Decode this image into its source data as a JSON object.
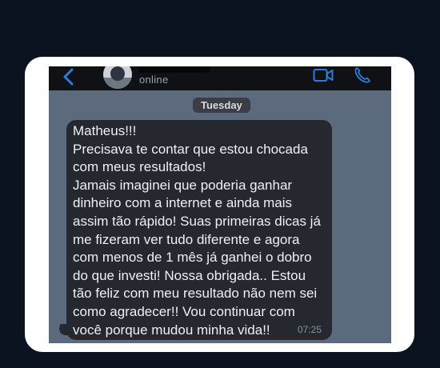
{
  "header": {
    "status": "online",
    "back_icon": "chevron-left-icon",
    "video_icon": "video-call-icon",
    "phone_icon": "phone-icon",
    "accent_color": "#2f7bd8"
  },
  "chat": {
    "date_label": "Tuesday",
    "message": {
      "text": "Matheus!!!\nPrecisava te contar que estou chocada com meus resultados!\nJamais imaginei que poderia ganhar dinheiro com a internet e ainda mais assim tão rápido! Suas primeiras dicas já me fizeram ver tudo diferente e agora com menos de 1 mês já ganhei o dobro do que investi! Nossa obrigada.. Estou tão feliz com meu resultado não nem sei como agradecer!! Vou continuar com você porque mudou minha vida!!",
      "time": "07:25"
    }
  }
}
